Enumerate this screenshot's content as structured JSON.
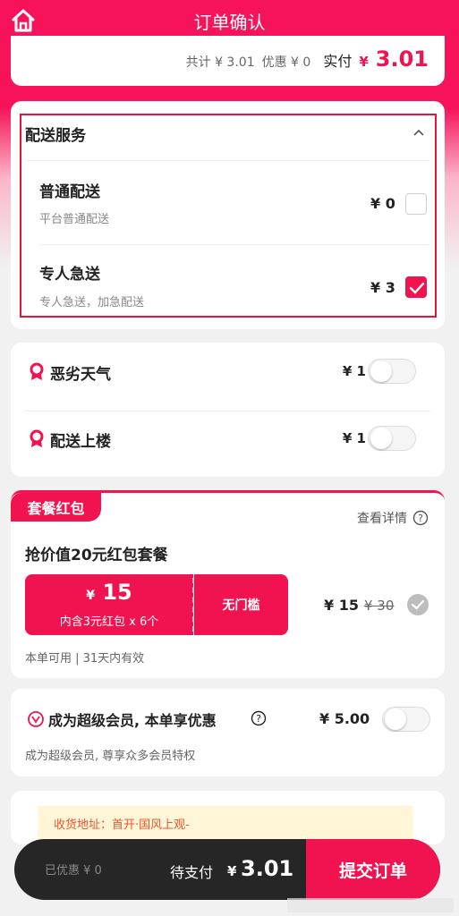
{
  "header": {
    "title": "订单确认",
    "home_icon": "home-icon"
  },
  "summary": {
    "total_text": "共计 ¥ 3.01",
    "discount_text": "优惠 ¥ 0",
    "pay_label": "实付",
    "pay_symbol": "¥",
    "pay_value": "3.01"
  },
  "delivery": {
    "title": "配送服务",
    "options": [
      {
        "title": "普通配送",
        "subtitle": "平台普通配送",
        "price": "¥ 0",
        "checked": false
      },
      {
        "title": "专人急送",
        "subtitle": "专人急送，加急配送",
        "price": "¥ 3",
        "checked": true
      }
    ]
  },
  "extras": [
    {
      "label": "恶劣天气",
      "price": "¥ 1",
      "enabled": false
    },
    {
      "label": "配送上楼",
      "price": "¥ 1",
      "enabled": false
    }
  ],
  "package": {
    "tag": "套餐红包",
    "details_label": "查看详情",
    "title": "抢价值20元红包套餐",
    "coupon_symbol": "¥",
    "coupon_amount": "15",
    "coupon_desc": "内含3元红包 x 6个",
    "coupon_right": "无门槛",
    "price": "¥ 15",
    "original_price": "¥ 30",
    "validity": "本单可用 | 31天内有效"
  },
  "vip": {
    "title": "成为超级会员, 本单享优惠",
    "price": "¥ 5.00",
    "subtitle": "成为超级会员, 尊享众多会员特权",
    "enabled": false
  },
  "address_notice": "收货地址：首开·国风上观-",
  "bottom": {
    "discount": "已优惠 ¥ 0",
    "due_label": "待支付",
    "due_symbol": "¥",
    "due_value": "3.01",
    "submit_label": "提交订单"
  },
  "colors": {
    "accent": "#f0134f",
    "dark_bar": "#262626"
  }
}
